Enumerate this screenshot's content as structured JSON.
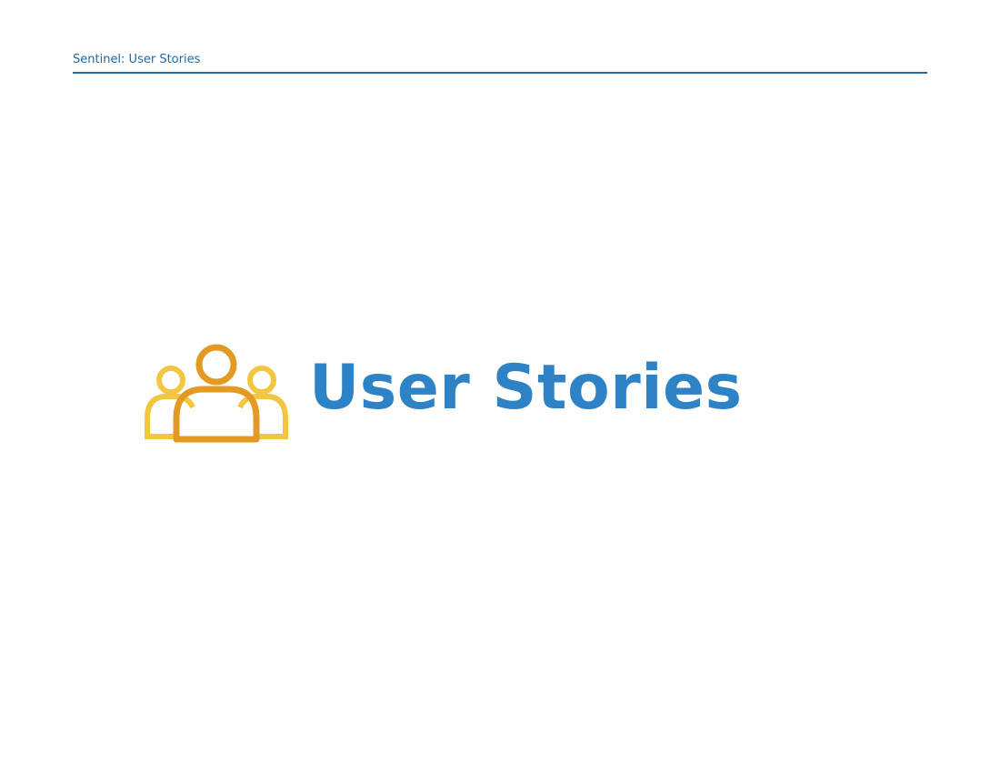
{
  "header": {
    "title": "Sentinel: User Stories"
  },
  "hero": {
    "icon": "users-group-icon",
    "title": "User Stories"
  },
  "colors": {
    "accent_blue": "#2d83c6",
    "header_blue": "#1f6aa5",
    "icon_side_users": "#f2c641",
    "icon_center_user": "#e39a24"
  }
}
